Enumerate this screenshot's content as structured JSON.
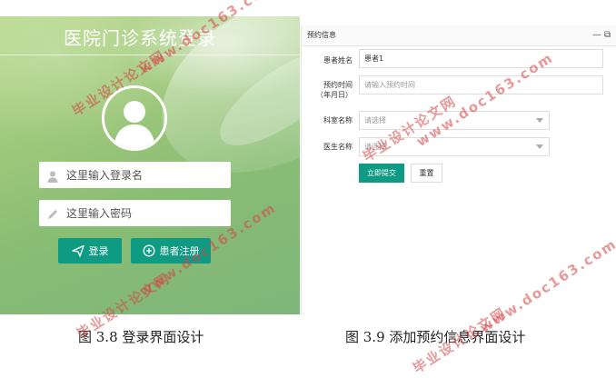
{
  "login": {
    "title": "医院门诊系统登录",
    "username_placeholder": "这里输入登录名",
    "password_placeholder": "这里输入密码",
    "login_button": "登录",
    "register_button": "患者注册"
  },
  "form": {
    "header_title": "预约信息",
    "fields": {
      "patient_name_label": "患者姓名",
      "patient_name_value": "患者1",
      "time_label_line1": "预约时间",
      "time_label_line2": "（年月日）",
      "time_placeholder": "请输入预约时间",
      "dept_label": "科室名称",
      "dept_placeholder": "请选择",
      "doctor_label": "医生名称",
      "doctor_placeholder": "请选择"
    },
    "submit_button": "立即提交",
    "reset_button": "重置"
  },
  "captions": {
    "left": "图 3.8 登录界面设计",
    "right": "图 3.9  添加预约信息界面设计"
  },
  "watermark": {
    "cn": "毕业设计论文网",
    "url": "www.doc163.com"
  },
  "colors": {
    "accent": "#0f9a83",
    "watermark": "#d64646"
  }
}
